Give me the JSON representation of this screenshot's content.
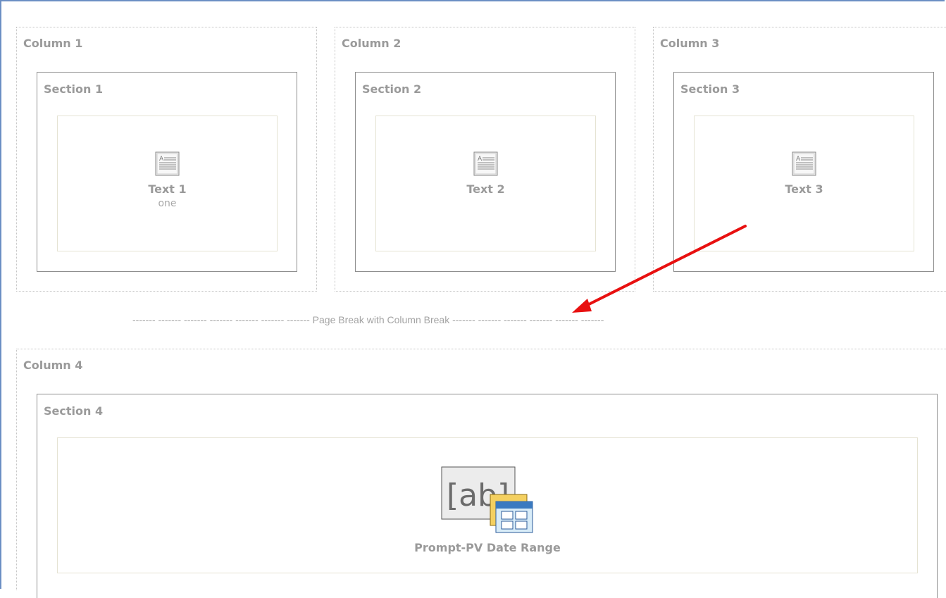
{
  "columns": [
    {
      "title": "Column 1",
      "section": {
        "title": "Section 1",
        "view": {
          "name": "Text 1",
          "sub": "one"
        }
      }
    },
    {
      "title": "Column 2",
      "section": {
        "title": "Section 2",
        "view": {
          "name": "Text 2",
          "sub": ""
        }
      }
    },
    {
      "title": "Column 3",
      "section": {
        "title": "Section 3",
        "view": {
          "name": "Text 3",
          "sub": ""
        }
      }
    }
  ],
  "page_break": {
    "label": "------- ------- ------- ------- ------- ------- ------- Page Break with Column Break ------- ------- ------- ------- ------- -------"
  },
  "column4": {
    "title": "Column 4",
    "section": {
      "title": "Section 4",
      "view": {
        "name": "Prompt-PV Date Range",
        "icon_text": "[ab]"
      }
    }
  },
  "colors": {
    "annotation_arrow": "#e81010",
    "frame_border": "#6b8fc4"
  }
}
